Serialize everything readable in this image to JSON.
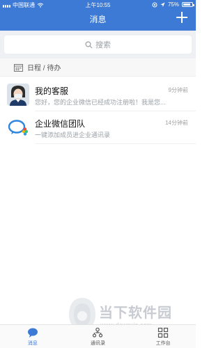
{
  "status_bar": {
    "carrier": "中国联通",
    "time": "上午10:55",
    "battery": "75%"
  },
  "header": {
    "title": "消息"
  },
  "search": {
    "placeholder": "搜索"
  },
  "agenda": {
    "label": "日程 / 待办"
  },
  "chats": [
    {
      "name": "我的客服",
      "preview": "您好，您的企业微信已经成功注册啦！我是您...",
      "time": "9分钟前"
    },
    {
      "name": "企业微信团队",
      "preview": "一键添加成员进企业通讯录",
      "time": "14分钟前"
    }
  ],
  "tabs": [
    {
      "label": "消息",
      "icon": "chat-bubble-icon",
      "active": true
    },
    {
      "label": "通讯录",
      "icon": "contacts-icon",
      "active": false
    },
    {
      "label": "工作台",
      "icon": "workbench-grid-icon",
      "active": false
    }
  ],
  "watermark": {
    "name": "当下软件园",
    "url": "www.downxia.com"
  },
  "colors": {
    "brand": "#3c7ad6",
    "background": "#eef0f3"
  }
}
